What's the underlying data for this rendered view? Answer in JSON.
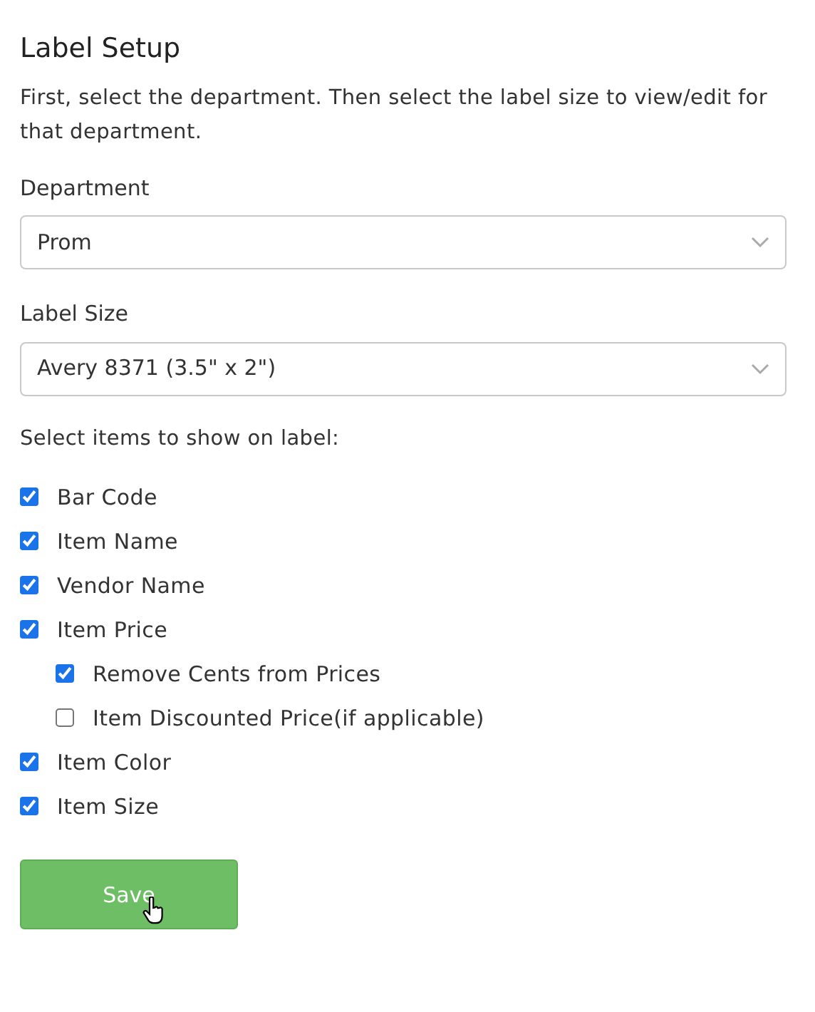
{
  "title": "Label Setup",
  "description": "First, select the department. Then select the label size to view/edit for that department.",
  "fields": [
    {
      "label": "Department",
      "value": "Prom"
    },
    {
      "label": "Label Size",
      "value": "Avery 8371 (3.5\" x 2\")"
    }
  ],
  "items_heading": "Select items to show on label:",
  "items": [
    {
      "label": "Bar Code",
      "checked": true
    },
    {
      "label": "Item Name",
      "checked": true
    },
    {
      "label": "Vendor Name",
      "checked": true
    },
    {
      "label": "Item Price",
      "checked": true,
      "children": [
        {
          "label": "Remove Cents from Prices",
          "checked": true
        },
        {
          "label": "Item Discounted Price(if applicable)",
          "checked": false
        }
      ]
    },
    {
      "label": "Item Color",
      "checked": true
    },
    {
      "label": "Item Size",
      "checked": true
    }
  ],
  "save_button": "Save"
}
